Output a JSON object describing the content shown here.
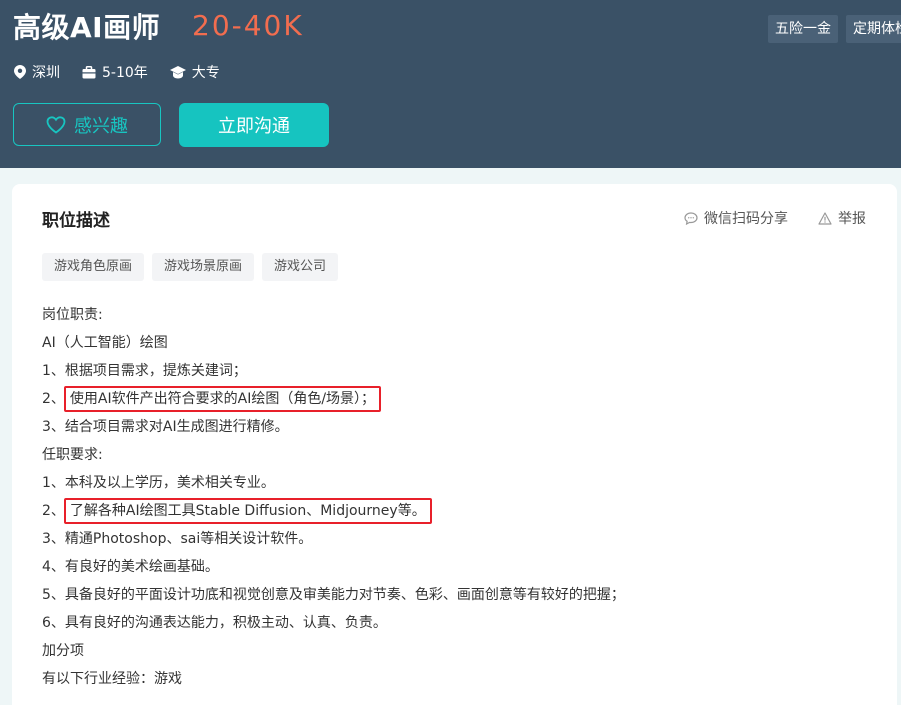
{
  "header": {
    "job_title": "高级AI画师",
    "salary": "20-40K",
    "benefits": [
      "五险一金",
      "定期体检"
    ],
    "meta": {
      "location": "深圳",
      "experience": "5-10年",
      "education": "大专"
    },
    "like_button": "感兴趣",
    "chat_button": "立即沟通"
  },
  "colors": {
    "header_bg": "#3a5166",
    "accent": "#16c4c0",
    "salary": "#f26d4f",
    "highlight_border": "#e8202a"
  },
  "card": {
    "title": "职位描述",
    "share": "微信扫码分享",
    "report": "举报",
    "tags": [
      "游戏角色原画",
      "游戏场景原画",
      "游戏公司"
    ],
    "lines": [
      "岗位职责:",
      "AI（人工智能）绘图",
      "1、根据项目需求，提炼关建词；",
      {
        "prefix": "2、",
        "text": "使用AI软件产出符合要求的AI绘图（角色/场景）；"
      },
      "3、结合项目需求对AI生成图进行精修。",
      "任职要求:",
      "1、本科及以上学历，美术相关专业。",
      {
        "prefix": "2、",
        "text": "了解各种AI绘图工具Stable Diffusion、Midjourney等。"
      },
      "3、精通Photoshop、sai等相关设计软件。",
      "4、有良好的美术绘画基础。",
      "5、具备良好的平面设计功底和视觉创意及审美能力对节奏、色彩、画面创意等有较好的把握；",
      "6、具有良好的沟通表达能力，积极主动、认真、负责。",
      "加分项",
      "有以下行业经验：游戏"
    ]
  },
  "icons": {
    "location": "location-pin-icon",
    "experience": "briefcase-icon",
    "education": "graduation-cap-icon",
    "like": "heart-icon",
    "share": "chat-bubble-icon",
    "report": "warning-icon"
  }
}
